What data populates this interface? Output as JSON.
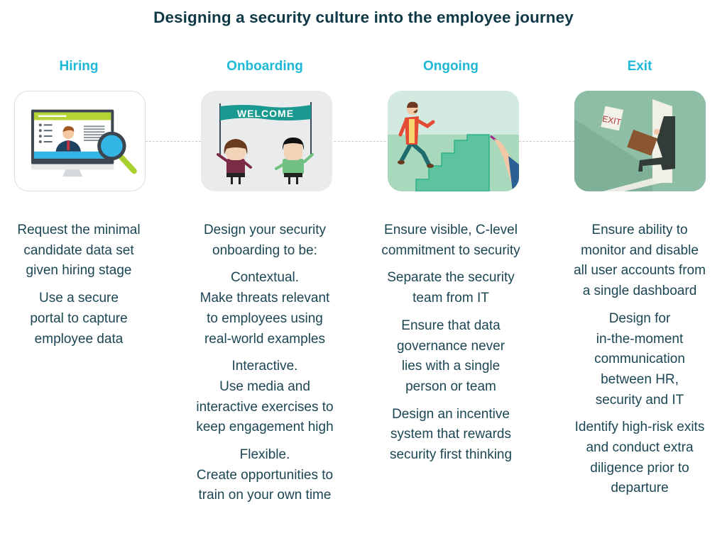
{
  "title": "Designing a security culture into the employee journey",
  "colors": {
    "title": "#0f3947",
    "stage_heading": "#1db9d6",
    "body_text": "#1c4654",
    "connector": "#c4c8ca"
  },
  "stages": [
    {
      "heading": "Hiring",
      "illustration": "computer-monitor-candidate-profile-magnifier",
      "paragraphs": [
        "Request the minimal\ncandidate data set\ngiven hiring stage",
        "Use a secure\nportal to capture\nemployee data"
      ]
    },
    {
      "heading": "Onboarding",
      "illustration": "two-people-holding-welcome-banner",
      "banner_text": "WELCOME",
      "paragraphs": [
        "Design your security\nonboarding to be:",
        "Contextual.\nMake threats relevant\nto employees using\nreal-world examples",
        "Interactive.\nUse media and\ninteractive exercises to\nkeep engagement high",
        "Flexible.\nCreate opportunities to\ntrain on your own time"
      ]
    },
    {
      "heading": "Ongoing",
      "illustration": "man-climbing-drawn-stairs",
      "paragraphs": [
        "Ensure visible, C-level\ncommitment to security",
        "Separate the security\nteam from IT",
        "Ensure that data\ngovernance never\nlies with a single\nperson or team",
        "Design an incentive\nsystem that rewards\nsecurity first thinking"
      ]
    },
    {
      "heading": "Exit",
      "illustration": "businessman-leaving-through-exit-door",
      "sign_text": "EXIT",
      "paragraphs": [
        "Ensure ability to\nmonitor and disable\nall user accounts from\na single dashboard",
        "Design for\nin-the-moment\ncommunication\nbetween HR,\nsecurity and IT",
        "Identify high-risk exits\nand conduct extra\ndiligence prior to\ndeparture"
      ]
    }
  ]
}
